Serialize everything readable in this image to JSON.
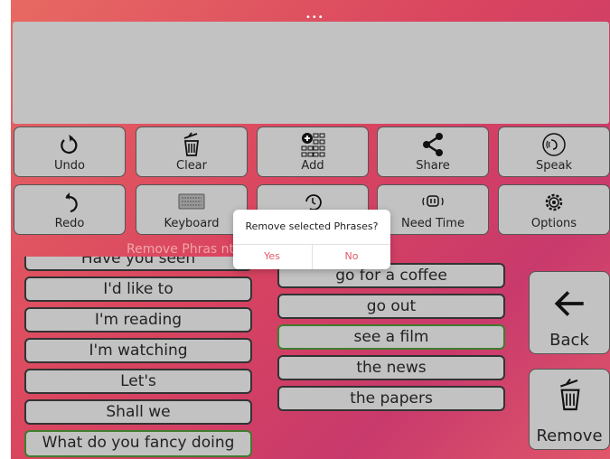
{
  "top_indicator": "•••",
  "toolbar": {
    "row1": [
      {
        "label": "Undo",
        "icon": "undo-icon"
      },
      {
        "label": "Clear",
        "icon": "trash-icon"
      },
      {
        "label": "Add",
        "icon": "add-grid-icon"
      },
      {
        "label": "Share",
        "icon": "share-icon"
      },
      {
        "label": "Speak",
        "icon": "speak-icon"
      }
    ],
    "row2": [
      {
        "label": "Redo",
        "icon": "redo-icon"
      },
      {
        "label": "Keyboard",
        "icon": "keyboard-icon"
      },
      {
        "label": "",
        "icon": "history-icon"
      },
      {
        "label": "Need Time",
        "icon": "need-time-icon"
      },
      {
        "label": "Options",
        "icon": "gear-icon"
      }
    ]
  },
  "section_header": "Remove Phras                              nt",
  "left_phrases": [
    "Have you seen",
    "I'd like to",
    "I'm reading",
    "I'm watching",
    "Let's",
    "Shall we",
    "What do you fancy doing"
  ],
  "right_phrases": [
    "go for a coffee",
    "go out",
    "see a film",
    "the news",
    "the papers"
  ],
  "side": {
    "back_label": "Back",
    "remove_label": "Remove"
  },
  "dialog": {
    "message": "Remove selected Phrases?",
    "yes": "Yes",
    "no": "No"
  },
  "colors": {
    "accent": "#e4586c",
    "button_bg": "#c2c2c2",
    "selected_border": "#3f7d2e"
  }
}
